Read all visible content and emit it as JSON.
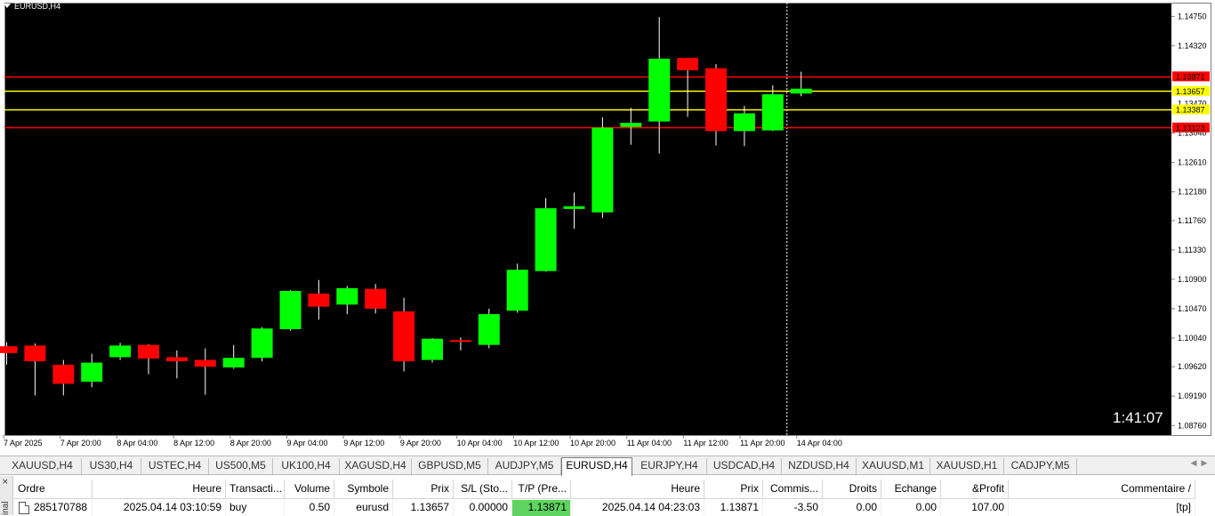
{
  "window": {
    "symbol_title": "EURUSD,H4"
  },
  "timer": "1:41:07",
  "colors": {
    "background": "#000000",
    "bull": "#00ff00",
    "bear": "#ff0000",
    "wick": "#ffffff",
    "grid_text": "#ffffff",
    "sl_line": "#ff0000",
    "entry_line": "#ffff00",
    "tp_cell": "#5fd35f"
  },
  "chart_data": {
    "type": "candlestick",
    "symbol": "EURUSD",
    "timeframe": "H4",
    "y_ticks": [
      "1.14750",
      "1.14320",
      "1.13040",
      "1.12610",
      "1.12180",
      "1.11760",
      "1.11330",
      "1.10900",
      "1.10470",
      "1.10040",
      "1.09620",
      "1.09190",
      "1.08760"
    ],
    "ylim": [
      1.0862,
      1.1495
    ],
    "x_ticks": [
      "7 Apr 2025",
      "7 Apr 20:00",
      "8 Apr 04:00",
      "8 Apr 12:00",
      "8 Apr 20:00",
      "9 Apr 04:00",
      "9 Apr 12:00",
      "9 Apr 20:00",
      "10 Apr 04:00",
      "10 Apr 12:00",
      "10 Apr 20:00",
      "11 Apr 04:00",
      "11 Apr 12:00",
      "11 Apr 20:00",
      "14 Apr 04:00"
    ],
    "candles": [
      {
        "o": 1.0992,
        "h": 1.0998,
        "l": 1.0965,
        "c": 1.0982
      },
      {
        "o": 1.0993,
        "h": 1.0996,
        "l": 1.092,
        "c": 1.097
      },
      {
        "o": 1.0965,
        "h": 1.0972,
        "l": 1.092,
        "c": 1.0937
      },
      {
        "o": 1.094,
        "h": 1.0981,
        "l": 1.0932,
        "c": 1.0968
      },
      {
        "o": 1.0976,
        "h": 1.0997,
        "l": 1.0972,
        "c": 1.0993
      },
      {
        "o": 1.0994,
        "h": 1.0995,
        "l": 1.0951,
        "c": 1.0974
      },
      {
        "o": 1.0976,
        "h": 1.0986,
        "l": 1.0945,
        "c": 1.097
      },
      {
        "o": 1.0972,
        "h": 1.0989,
        "l": 1.0921,
        "c": 1.0962
      },
      {
        "o": 1.0961,
        "h": 1.0994,
        "l": 1.0959,
        "c": 1.0975
      },
      {
        "o": 1.0975,
        "h": 1.102,
        "l": 1.097,
        "c": 1.1018
      },
      {
        "o": 1.1017,
        "h": 1.1074,
        "l": 1.1015,
        "c": 1.1073
      },
      {
        "o": 1.1069,
        "h": 1.1089,
        "l": 1.1031,
        "c": 1.105
      },
      {
        "o": 1.1053,
        "h": 1.108,
        "l": 1.1039,
        "c": 1.1077
      },
      {
        "o": 1.1076,
        "h": 1.1083,
        "l": 1.104,
        "c": 1.1047
      },
      {
        "o": 1.1043,
        "h": 1.1063,
        "l": 1.0955,
        "c": 1.097
      },
      {
        "o": 1.0972,
        "h": 1.1004,
        "l": 1.0968,
        "c": 1.1003
      },
      {
        "o": 1.1001,
        "h": 1.1005,
        "l": 1.0986,
        "c": 1.0999
      },
      {
        "o": 1.0994,
        "h": 1.1047,
        "l": 1.0989,
        "c": 1.1039
      },
      {
        "o": 1.1044,
        "h": 1.1113,
        "l": 1.1041,
        "c": 1.1104
      },
      {
        "o": 1.1102,
        "h": 1.1209,
        "l": 1.1101,
        "c": 1.1194
      },
      {
        "o": 1.1193,
        "h": 1.1217,
        "l": 1.1164,
        "c": 1.1197
      },
      {
        "o": 1.1188,
        "h": 1.1327,
        "l": 1.118,
        "c": 1.1312
      },
      {
        "o": 1.1313,
        "h": 1.1341,
        "l": 1.1287,
        "c": 1.1319
      },
      {
        "o": 1.1321,
        "h": 1.1474,
        "l": 1.1274,
        "c": 1.1413
      },
      {
        "o": 1.1414,
        "h": 1.1414,
        "l": 1.1328,
        "c": 1.1396
      },
      {
        "o": 1.1399,
        "h": 1.1405,
        "l": 1.1286,
        "c": 1.1307
      },
      {
        "o": 1.1307,
        "h": 1.1344,
        "l": 1.1285,
        "c": 1.1333
      },
      {
        "o": 1.1308,
        "h": 1.1374,
        "l": 1.1307,
        "c": 1.1361
      },
      {
        "o": 1.1362,
        "h": 1.1394,
        "l": 1.1358,
        "c": 1.1369
      }
    ],
    "levels": [
      {
        "price": 1.13871,
        "label": "1.13871",
        "kind": "tp"
      },
      {
        "price": 1.13657,
        "label": "1.13657",
        "kind": "entry"
      },
      {
        "price": 1.13387,
        "label": "1.13387",
        "kind": "entry"
      },
      {
        "price": 1.13123,
        "label": "1.13123",
        "kind": "sl"
      }
    ],
    "partial_tick": "1.13470",
    "cursor_date_index": 27.5,
    "grid": false
  },
  "tabs": [
    {
      "label": "XAUUSD,H4"
    },
    {
      "label": "US30,H4"
    },
    {
      "label": "USTEC,H4"
    },
    {
      "label": "US500,M5"
    },
    {
      "label": "UK100,H4"
    },
    {
      "label": "XAGUSD,H4"
    },
    {
      "label": "GBPUSD,M5"
    },
    {
      "label": "AUDJPY,M5"
    },
    {
      "label": "EURUSD,H4",
      "active": true
    },
    {
      "label": "EURJPY,H4"
    },
    {
      "label": "USDCAD,H4"
    },
    {
      "label": "NZDUSD,H4"
    },
    {
      "label": "XAUUSD,M1"
    },
    {
      "label": "XAUUSD,H1"
    },
    {
      "label": "CADJPY,M5"
    }
  ],
  "terminal": {
    "side_label": "inal",
    "close_glyph": "×",
    "headers": [
      "Ordre",
      "Heure",
      "Transacti...",
      "Volume",
      "Symbole",
      "Prix",
      "S/L (Sto...",
      "T/P (Pre...",
      "Heure",
      "Prix",
      "Commis...",
      "Droits",
      "Echange",
      "&Profit",
      "Commentaire  /"
    ],
    "row": [
      "285170788",
      "2025.04.14 03:10:59",
      "buy",
      "0.50",
      "eurusd",
      "1.13657",
      "0.00000",
      "1.13871",
      "2025.04.14 04:23:03",
      "1.13871",
      "-3.50",
      "0.00",
      "0.00",
      "107.00",
      "[tp]"
    ]
  }
}
